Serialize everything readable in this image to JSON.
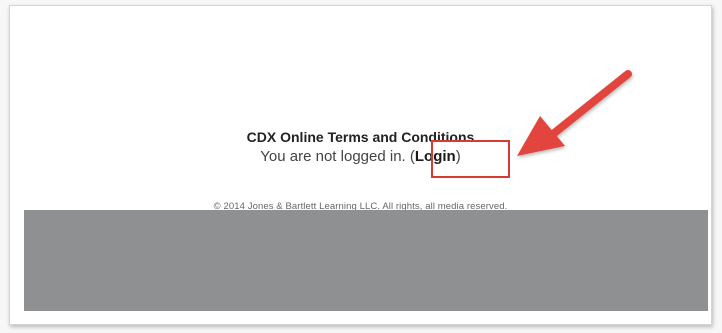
{
  "page": {
    "terms_title": "CDX Online Terms and Conditions",
    "login_prefix": "You are not logged in. (",
    "login_link": "Login",
    "login_suffix": ")",
    "copyright": "© 2014 Jones & Bartlett Learning LLC. All rights, all media reserved."
  },
  "annotation": {
    "highlight_color": "#d83a34",
    "arrow_color": "#e2443c"
  },
  "footer": {
    "band_color": "#8e9091"
  }
}
